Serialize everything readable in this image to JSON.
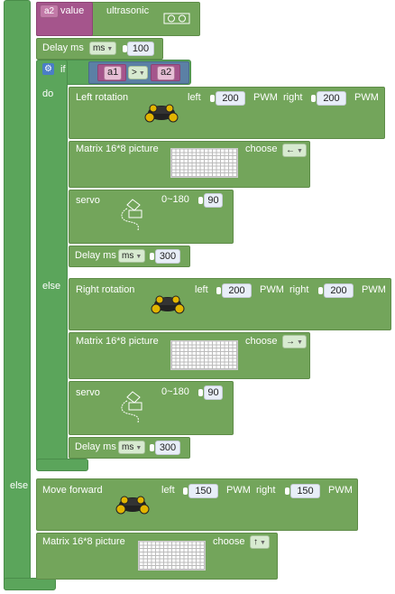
{
  "top_block": {
    "var": "a2",
    "value_label": "value",
    "sensor_label": "ultrasonic"
  },
  "delay_top": {
    "label": "Delay ms",
    "unit": "ms",
    "value": "100"
  },
  "if_block": {
    "if_label": "if",
    "do_label": "do",
    "else_label": "else",
    "left_var": "a1",
    "operator": ">",
    "right_var": "a2"
  },
  "do_branch": {
    "rotation": {
      "label": "Left rotation",
      "left_label": "left",
      "left_value": "200",
      "left_unit": "PWM",
      "right_label": "right",
      "right_value": "200",
      "right_unit": "PWM"
    },
    "matrix": {
      "label": "Matrix 16*8 picture",
      "choose_label": "choose",
      "choice": "←"
    },
    "servo": {
      "label": "servo",
      "range_label": "0~180",
      "value": "90"
    },
    "delay": {
      "label": "Delay ms",
      "unit": "ms",
      "value": "300"
    }
  },
  "else_branch": {
    "rotation": {
      "label": "Right rotation",
      "left_label": "left",
      "left_value": "200",
      "left_unit": "PWM",
      "right_label": "right",
      "right_value": "200",
      "right_unit": "PWM"
    },
    "matrix": {
      "label": "Matrix 16*8 picture",
      "choose_label": "choose",
      "choice": "→"
    },
    "servo": {
      "label": "servo",
      "range_label": "0~180",
      "value": "90"
    },
    "delay": {
      "label": "Delay ms",
      "unit": "ms",
      "value": "300"
    }
  },
  "outer_else": {
    "else_label": "else",
    "move": {
      "label": "Move forward",
      "left_label": "left",
      "left_value": "150",
      "left_unit": "PWM",
      "right_label": "right",
      "right_value": "150",
      "right_unit": "PWM"
    },
    "matrix": {
      "label": "Matrix 16*8 picture",
      "choose_label": "choose",
      "choice": "↑"
    }
  },
  "colors": {
    "outer_green": "#5ba55b",
    "block_green": "#73a55b",
    "variable_pink": "#a5558c",
    "logic_blue": "#5b80a5"
  }
}
